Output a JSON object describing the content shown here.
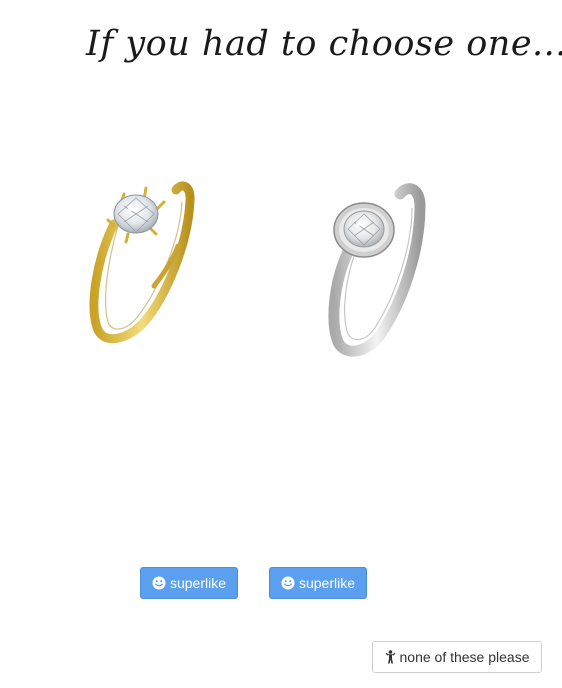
{
  "heading": "If you had to choose one...",
  "options": [
    {
      "image_icon": "gold-solitaire-ring",
      "button_icon": "smile-icon",
      "button_label": "superlike"
    },
    {
      "image_icon": "silver-bezel-ring",
      "button_icon": "smile-icon",
      "button_label": "superlike"
    }
  ],
  "none_button": {
    "icon": "child-icon",
    "label": "none of these please"
  },
  "colors": {
    "superlike_bg": "#5aa0ee",
    "superlike_border": "#4b8fdb",
    "none_border": "#cfcfcf",
    "gold": "#d9b53c",
    "silver": "#c8c8c8"
  }
}
